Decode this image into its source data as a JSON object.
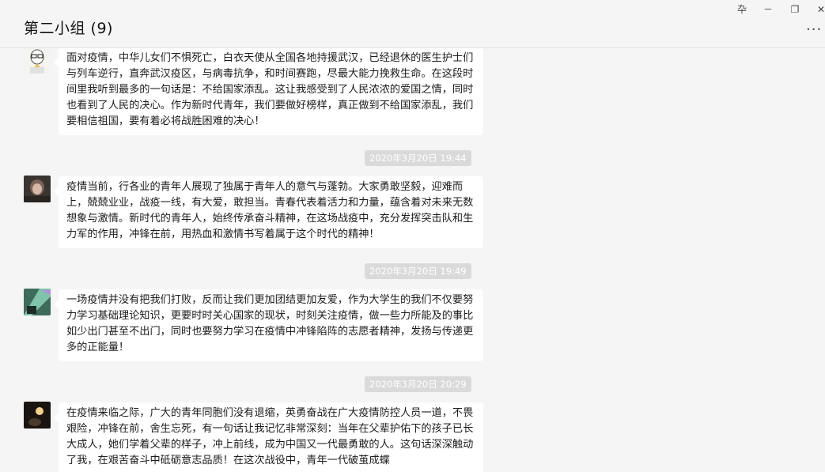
{
  "window": {
    "title": "第二小组 (9)",
    "pin_icon": "卆",
    "minimize_icon": "－",
    "restore_icon": "❐",
    "close_icon": "✕",
    "more_icon": "···"
  },
  "messages": [
    {
      "text": "面对疫情，中华儿女们不惧死亡，白衣天使从全国各地持援武汉，已经退休的医生护士们与列车逆行，直奔武汉疫区，与病毒抗争，和时间赛跑，尽最大能力挽救生命。在这段时间里我听到最多的一句话是：不给国家添乱。这让我感受到了人民浓浓的爱国之情，同时也看到了人民的决心。作为新时代青年，我们要做好榜样，真正做到不给国家添乱，我们要相信祖国，要有着必将战胜困难的决心！"
    },
    {
      "time": "2020年3月20日 19:44",
      "text": "疫情当前，行各业的青年人展现了独属于青年人的意气与蓬勃。大家勇敢坚毅，迎难而上，兢兢业业，战疫一线，有大爱，敢担当。青春代表着活力和力量，蕴含着对未来无数想象与激情。新时代的青年人，始终传承奋斗精神，在这场战疫中，充分发挥突击队和生力军的作用，冲锋在前，用热血和激情书写着属于这个时代的精神！"
    },
    {
      "time": "2020年3月20日 19:49",
      "text": "一场疫情并没有把我们打败，反而让我们更加团结更加友爱，作为大学生的我们不仅要努力学习基础理论知识，更要时时关心国家的现状，时刻关注疫情，做一些力所能及的事比如少出门甚至不出门，同时也要努力学习在疫情中冲锋陷阵的志愿者精神，发扬与传递更多的正能量！"
    },
    {
      "time": "2020年3月20日 20:29",
      "text": "在疫情来临之际，广大的青年同胞们没有退缩，英勇奋战在广大疫情防控人员一道，不畏艰险，冲锋在前，舍生忘死，有一句话让我记忆非常深刻：当年在父辈护佑下的孩子已长大成人，她们学着父辈的样子，冲上前线，成为中国又一代最勇敢的人。这句话深深触动了我，在艰苦奋斗中砥砺意志品质！在这次战役中，青年一代破茧成蝶"
    }
  ]
}
